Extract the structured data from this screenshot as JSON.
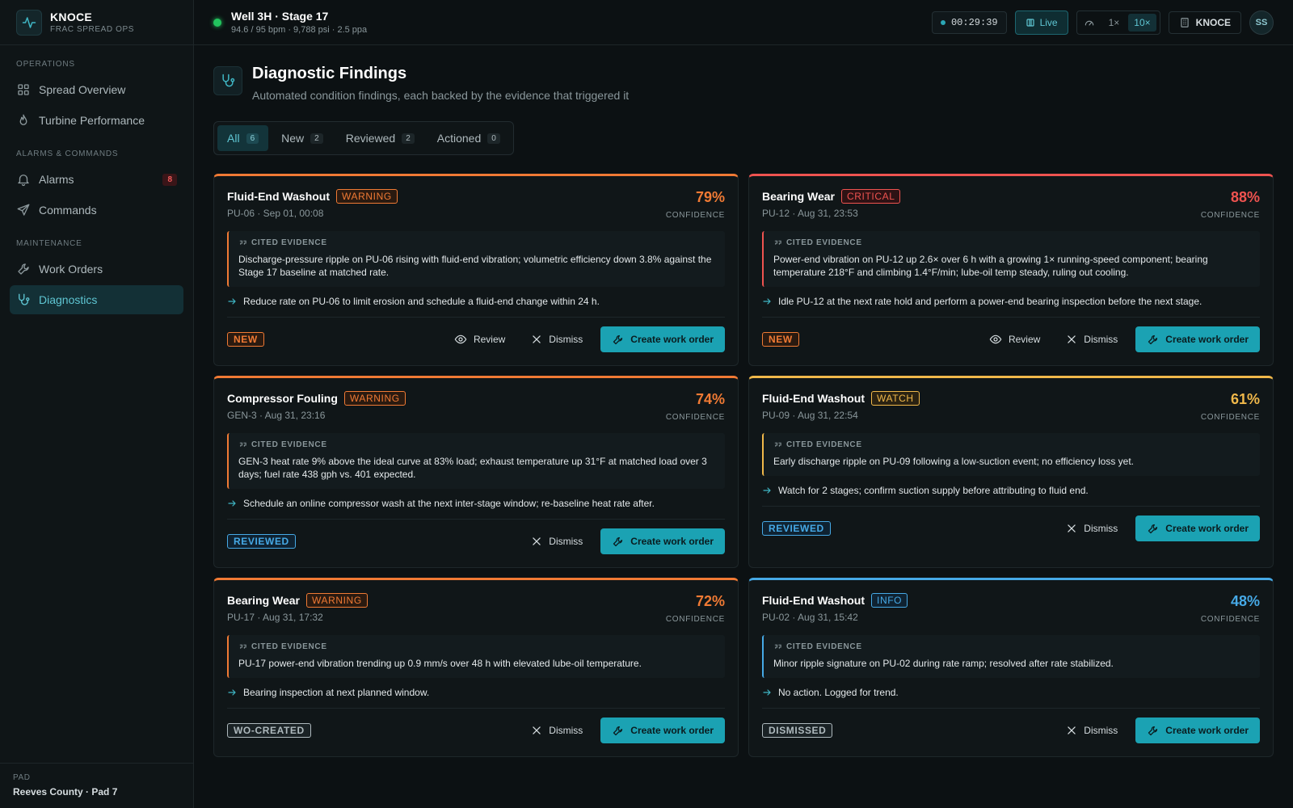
{
  "brand": {
    "name": "KNOCE",
    "subtitle": "FRAC SPREAD OPS"
  },
  "sidebar": {
    "sections": [
      {
        "title": "OPERATIONS",
        "items": [
          {
            "label": "Spread Overview",
            "icon": "grid-icon"
          },
          {
            "label": "Turbine Performance",
            "icon": "flame-icon"
          }
        ]
      },
      {
        "title": "ALARMS & COMMANDS",
        "items": [
          {
            "label": "Alarms",
            "icon": "bell-icon",
            "badge": "8"
          },
          {
            "label": "Commands",
            "icon": "send-icon"
          }
        ]
      },
      {
        "title": "MAINTENANCE",
        "items": [
          {
            "label": "Work Orders",
            "icon": "wrench-icon"
          },
          {
            "label": "Diagnostics",
            "icon": "stethoscope-icon",
            "active": true
          }
        ]
      }
    ],
    "footer": {
      "label": "PAD",
      "value": "Reeves County · Pad 7"
    }
  },
  "topbar": {
    "title": "Well 3H · Stage 17",
    "subtitle": "94.6 / 95 bpm · 9,788 psi · 2.5 ppa",
    "timer": "00:29:39",
    "live_label": "Live",
    "speed_options": [
      "1×",
      "10×"
    ],
    "speed_selected": "10×",
    "org": "KNOCE",
    "avatar": "SS"
  },
  "page": {
    "title": "Diagnostic Findings",
    "subtitle": "Automated condition findings, each backed by the evidence that triggered it"
  },
  "tabs": [
    {
      "label": "All",
      "count": "6",
      "active": true
    },
    {
      "label": "New",
      "count": "2"
    },
    {
      "label": "Reviewed",
      "count": "2"
    },
    {
      "label": "Actioned",
      "count": "0"
    }
  ],
  "labels": {
    "confidence": "CONFIDENCE",
    "cited_evidence": "CITED EVIDENCE",
    "review": "Review",
    "dismiss": "Dismiss",
    "create_work_order": "Create work order"
  },
  "colors": {
    "warning": "#f07a34",
    "critical": "#ef5350",
    "watch": "#f0b84a",
    "info": "#46a9e6",
    "accent": "#1ba2b3"
  },
  "findings": [
    {
      "title": "Fluid-End Washout",
      "severity": "WARNING",
      "sev_key": "warning",
      "meta": "PU-06 · Sep 01, 00:08",
      "confidence": "79%",
      "evidence": "Discharge-pressure ripple on PU-06 rising with fluid-end vibration; volumetric efficiency down 3.8% against the Stage 17 baseline at matched rate.",
      "recommendation": "Reduce rate on PU-06 to limit erosion and schedule a fluid-end change within 24 h.",
      "status": "NEW",
      "status_key": "new",
      "show_review": true
    },
    {
      "title": "Bearing Wear",
      "severity": "CRITICAL",
      "sev_key": "critical",
      "meta": "PU-12 · Aug 31, 23:53",
      "confidence": "88%",
      "evidence": "Power-end vibration on PU-12 up 2.6× over 6 h with a growing 1× running-speed component; bearing temperature 218°F and climbing 1.4°F/min; lube-oil temp steady, ruling out cooling.",
      "recommendation": "Idle PU-12 at the next rate hold and perform a power-end bearing inspection before the next stage.",
      "status": "NEW",
      "status_key": "new",
      "show_review": true
    },
    {
      "title": "Compressor Fouling",
      "severity": "WARNING",
      "sev_key": "warning",
      "meta": "GEN-3 · Aug 31, 23:16",
      "confidence": "74%",
      "evidence": "GEN-3 heat rate 9% above the ideal curve at 83% load; exhaust temperature up 31°F at matched load over 3 days; fuel rate 438 gph vs. 401 expected.",
      "recommendation": "Schedule an online compressor wash at the next inter-stage window; re-baseline heat rate after.",
      "status": "REVIEWED",
      "status_key": "reviewed",
      "show_review": false
    },
    {
      "title": "Fluid-End Washout",
      "severity": "WATCH",
      "sev_key": "watch",
      "meta": "PU-09 · Aug 31, 22:54",
      "confidence": "61%",
      "evidence": "Early discharge ripple on PU-09 following a low-suction event; no efficiency loss yet.",
      "recommendation": "Watch for 2 stages; confirm suction supply before attributing to fluid end.",
      "status": "REVIEWED",
      "status_key": "reviewed",
      "show_review": false
    },
    {
      "title": "Bearing Wear",
      "severity": "WARNING",
      "sev_key": "warning",
      "meta": "PU-17 · Aug 31, 17:32",
      "confidence": "72%",
      "evidence": "PU-17 power-end vibration trending up 0.9 mm/s over 48 h with elevated lube-oil temperature.",
      "recommendation": "Bearing inspection at next planned window.",
      "status": "WO-CREATED",
      "status_key": "muted",
      "show_review": false
    },
    {
      "title": "Fluid-End Washout",
      "severity": "INFO",
      "sev_key": "info",
      "meta": "PU-02 · Aug 31, 15:42",
      "confidence": "48%",
      "evidence": "Minor ripple signature on PU-02 during rate ramp; resolved after rate stabilized.",
      "recommendation": "No action. Logged for trend.",
      "status": "DISMISSED",
      "status_key": "muted",
      "show_review": false
    }
  ]
}
